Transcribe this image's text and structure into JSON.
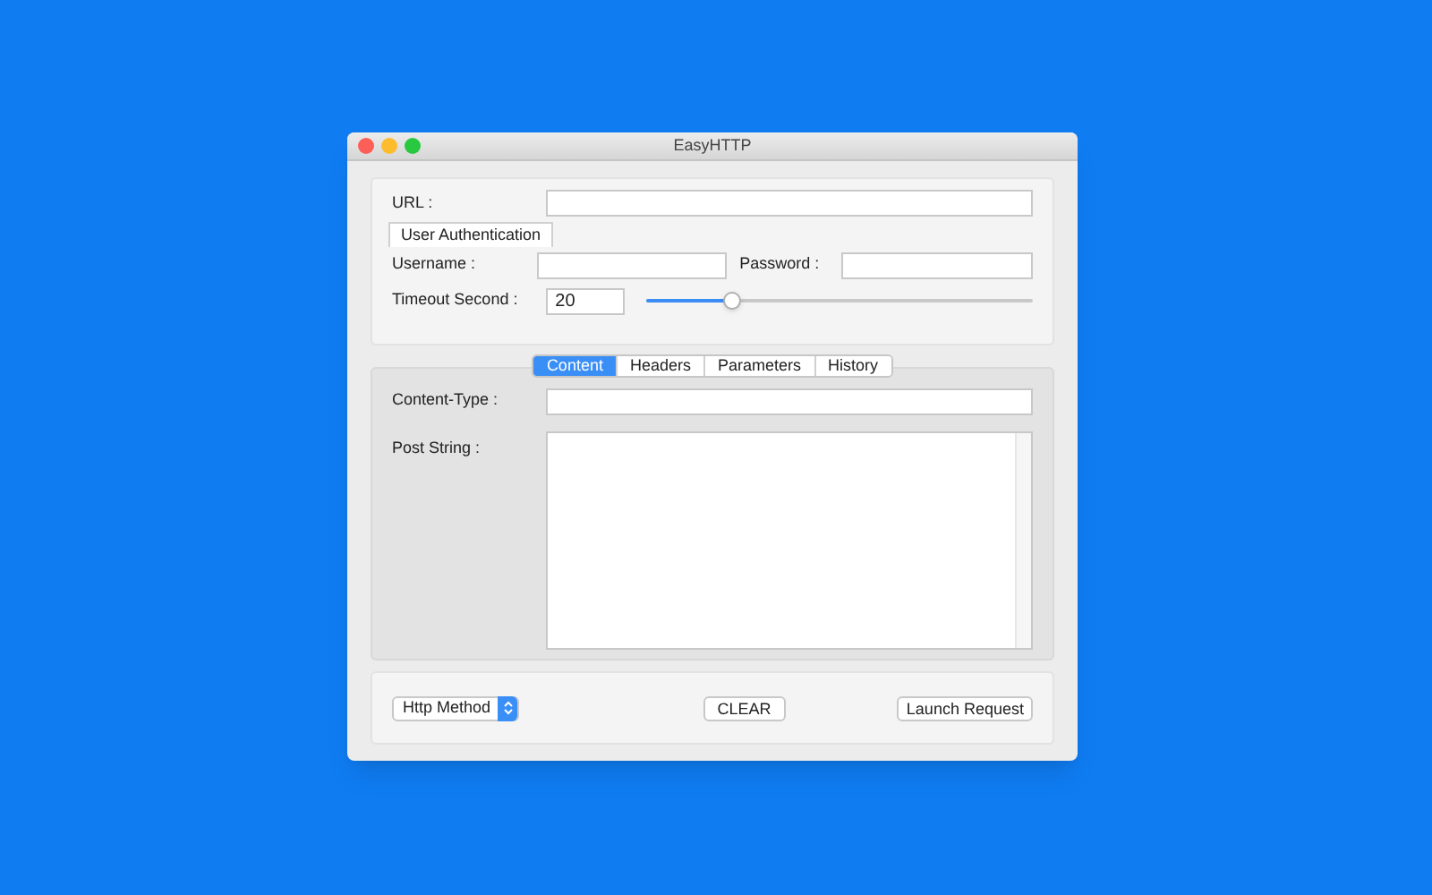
{
  "window": {
    "title": "EasyHTTP"
  },
  "url": {
    "label": "URL :"
  },
  "auth_button": "User Authentication",
  "username": {
    "label": "Username :"
  },
  "password": {
    "label": "Password :"
  },
  "timeout": {
    "label": "Timeout Second :",
    "value": "20",
    "level": 0.22
  },
  "tabs": [
    {
      "label": "Content",
      "selected": true
    },
    {
      "label": "Headers",
      "selected": false
    },
    {
      "label": "Parameters",
      "selected": false
    },
    {
      "label": "History",
      "selected": false
    }
  ],
  "content_type": {
    "label": "Content-Type :"
  },
  "post_string": {
    "label": "Post String :"
  },
  "http_method": "Http Method",
  "clear_button": "CLEAR",
  "launch_button": "Launch Request"
}
